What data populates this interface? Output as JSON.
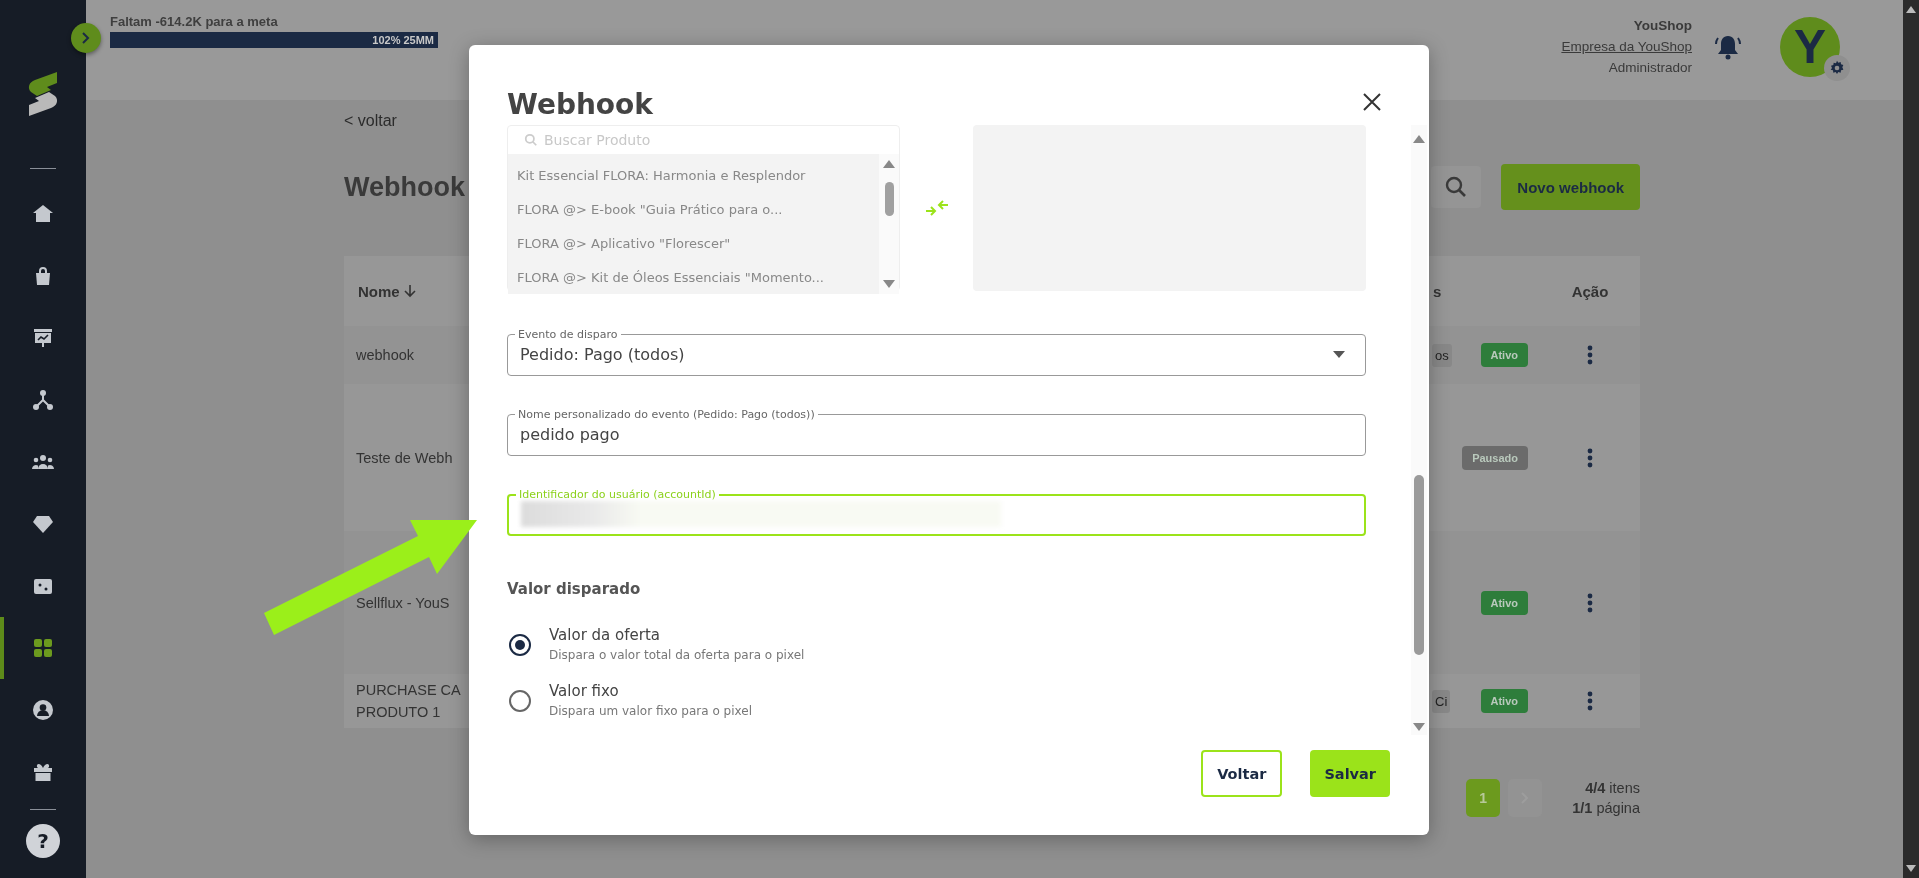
{
  "sidebar": {
    "items": [
      {
        "kind": "home",
        "selected": false
      },
      {
        "kind": "bag",
        "selected": false
      },
      {
        "kind": "board",
        "selected": false
      },
      {
        "kind": "network",
        "selected": false
      },
      {
        "kind": "people",
        "selected": false
      },
      {
        "kind": "diamond",
        "selected": false
      },
      {
        "kind": "ticket",
        "selected": false
      },
      {
        "kind": "apps",
        "selected": true
      },
      {
        "kind": "account",
        "selected": false
      },
      {
        "kind": "gift",
        "selected": false
      }
    ],
    "help": "?"
  },
  "goal": {
    "text": "Faltam **-614.2K** para a meta",
    "level": 1,
    "percent": "102%",
    "target": "25MM"
  },
  "user": {
    "name": "YouShop",
    "company": "Empresa da YouShop",
    "role": "Administrador",
    "avatar": "Y"
  },
  "page": {
    "back": "< voltar",
    "title": "Webhook",
    "new_button": "Novo webhook",
    "table": {
      "columns": [
        "Nome",
        "s",
        "Ação"
      ],
      "rows": [
        {
          "name": "webhook",
          "tag": "os",
          "status": "Ativo",
          "color": "#2e7d3b"
        },
        {
          "name": "Teste de Webh",
          "status": "Pausado",
          "color": "#6b6b6b"
        },
        {
          "name": "Sellflux - YouS",
          "status": "Ativo",
          "color": "#2e7d3b"
        },
        {
          "name": "PURCHASE CA PRODUTO 1",
          "tag": "Ci",
          "status": "Ativo",
          "color": "#2e7d3b"
        }
      ]
    },
    "pagination": {
      "pages": [
        {
          "label": "1",
          "selected": true
        }
      ],
      "count": "**4/4** itens",
      "pages_text": "**1/1** página"
    }
  },
  "modal": {
    "title": "Webhook",
    "products": {
      "placeholder": "Buscar Produto",
      "items": [
        "Kit Essencial FLORA: Harmonia e Resplendor",
        "FLORA @> E-book \"Guia Prático para o...",
        "FLORA @> Aplicativo \"Florescer\"",
        "FLORA @> Kit de Óleos Essenciais \"Momento..."
      ]
    },
    "fields": [
      {
        "kind": "select",
        "label": "Evento de disparo",
        "value": "Pedido: Pago (todos)",
        "focused": false
      },
      {
        "kind": "text",
        "label": "Nome personalizado do evento (Pedido: Pago (todos))",
        "value": "pedido pago",
        "focused": false
      },
      {
        "kind": "redacted",
        "label": "Identificador do usuário (accountId)",
        "focused": true
      }
    ],
    "value_section": {
      "title": "Valor disparado",
      "options": [
        {
          "label": "Valor da oferta",
          "description": "Dispara o valor total da oferta para o pixel",
          "selected": true
        },
        {
          "label": "Valor fixo",
          "description": "Dispara um valor fixo para o pixel",
          "selected": false
        }
      ]
    },
    "buttons": [
      {
        "label": "Voltar",
        "kind": "outline"
      },
      {
        "label": "Salvar",
        "kind": "primary"
      }
    ]
  }
}
